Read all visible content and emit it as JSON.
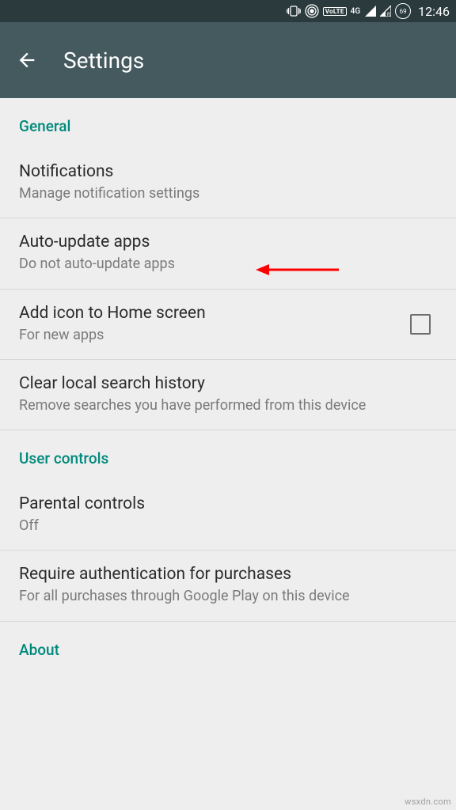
{
  "status": {
    "time": "12:46",
    "battery": "69",
    "volte": "VoLTE",
    "network": "4G"
  },
  "appbar": {
    "title": "Settings"
  },
  "sections": {
    "general": {
      "header": "General",
      "notifications": {
        "title": "Notifications",
        "subtitle": "Manage notification settings"
      },
      "auto_update": {
        "title": "Auto-update apps",
        "subtitle": "Do not auto-update apps"
      },
      "add_icon": {
        "title": "Add icon to Home screen",
        "subtitle": "For new apps"
      },
      "clear_search": {
        "title": "Clear local search history",
        "subtitle": "Remove searches you have performed from this device"
      }
    },
    "user_controls": {
      "header": "User controls",
      "parental": {
        "title": "Parental controls",
        "subtitle": "Off"
      },
      "require_auth": {
        "title": "Require authentication for purchases",
        "subtitle": "For all purchases through Google Play on this device"
      }
    },
    "about": {
      "header": "About"
    }
  },
  "watermark": "wsxdn.com"
}
